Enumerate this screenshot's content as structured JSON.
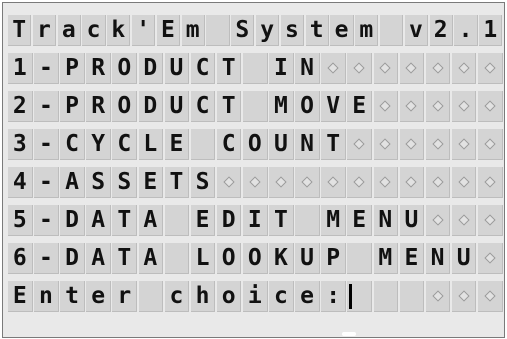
{
  "terminal": {
    "columns": 19,
    "lines": [
      {
        "name": "terminal-title",
        "text": "Track'Em System v2.1",
        "fill": "none",
        "interactive": false
      },
      {
        "name": "menu-option-product-in",
        "text": "1-PRODUCT IN",
        "fill": "dots",
        "interactive": true
      },
      {
        "name": "menu-option-product-move",
        "text": "2-PRODUCT MOVE",
        "fill": "dots",
        "interactive": true
      },
      {
        "name": "menu-option-cycle-count",
        "text": "3-CYCLE COUNT",
        "fill": "dots",
        "interactive": true
      },
      {
        "name": "menu-option-assets",
        "text": "4-ASSETS",
        "fill": "dots",
        "interactive": true
      },
      {
        "name": "menu-option-data-edit-menu",
        "text": "5-DATA EDIT MENU",
        "fill": "dots",
        "interactive": true
      },
      {
        "name": "menu-option-data-lookup-menu",
        "text": "6-DATA LOOKUP MENU",
        "fill": "dots",
        "interactive": true
      },
      {
        "name": "choice-prompt",
        "text": "Enter choice:",
        "fill": "input",
        "interactive": true
      }
    ],
    "input_value": "",
    "blank_cells_after_cursor": 2
  }
}
